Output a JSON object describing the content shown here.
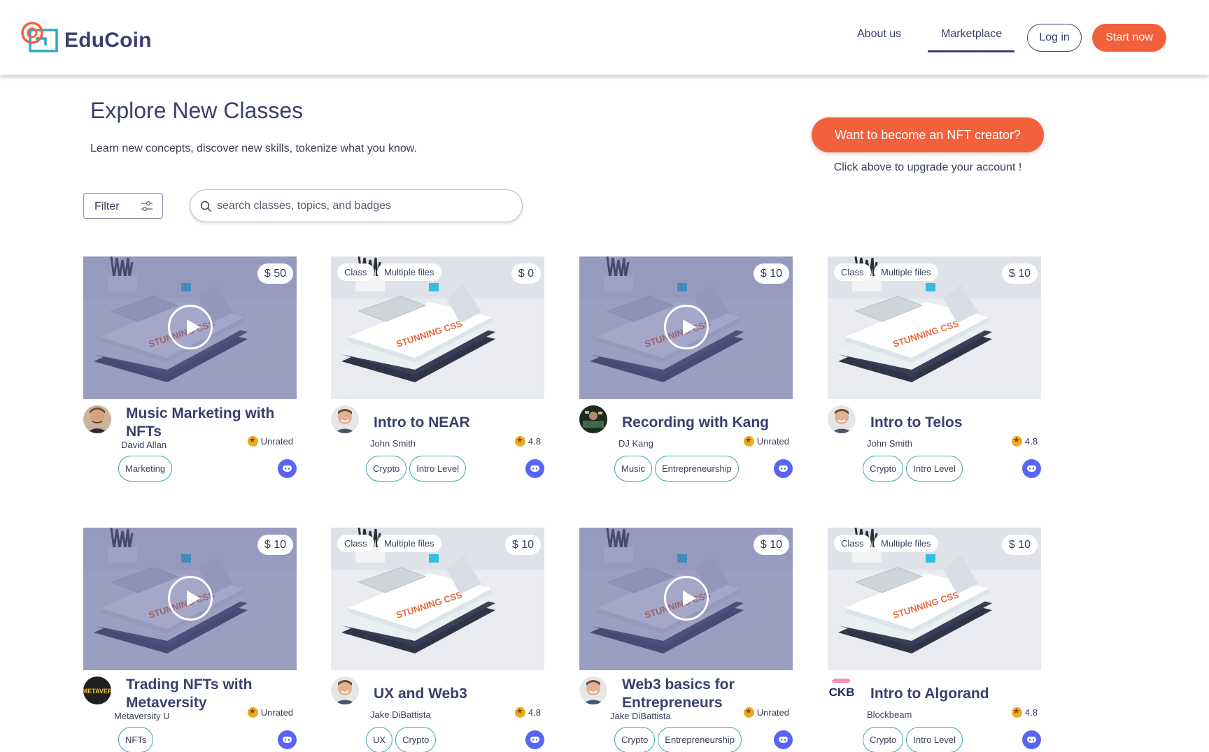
{
  "app": {
    "name": "EduCoin"
  },
  "nav": {
    "about": "About us",
    "marketplace": "Marketplace",
    "login": "Log in",
    "start": "Start now"
  },
  "page": {
    "title": "Explore New Classes",
    "subtitle": "Learn new concepts, discover new skills, tokenize what you know.",
    "creator_button": "Want to become an NFT creator?",
    "creator_note": "Click above to upgrade your account !"
  },
  "filter": {
    "label": "Filter"
  },
  "search": {
    "placeholder": "search classes, topics, and badges",
    "value": ""
  },
  "colors": {
    "accent": "#f2603c",
    "navy": "#3a3f6e",
    "tag_border": "#3aa8a8",
    "discord": "#5865f2",
    "overlay": "#5a5f9b"
  },
  "cards": [
    {
      "title": "Music Marketing with NFTs",
      "author": "David Allan",
      "rating": "Unrated",
      "price": "$ 50",
      "video": true,
      "chips": [],
      "tags": [
        "Marketing"
      ],
      "avatar": "man-mustache"
    },
    {
      "title": "Intro to NEAR",
      "author": "John Smith",
      "rating": "4.8",
      "price": "$ 0",
      "video": false,
      "chips": [
        "Class",
        "Multiple files"
      ],
      "tags": [
        "Crypto",
        "Intro Level"
      ],
      "avatar": "man-smiling"
    },
    {
      "title": "Recording with Kang",
      "author": "DJ Kang",
      "rating": "Unrated",
      "price": "$ 10",
      "video": true,
      "chips": [],
      "tags": [
        "Music",
        "Entrepreneurship"
      ],
      "avatar": "dj-studio"
    },
    {
      "title": "Intro to Telos",
      "author": "John Smith",
      "rating": "4.8",
      "price": "$ 10",
      "video": false,
      "chips": [
        "Class",
        "Multiple files"
      ],
      "tags": [
        "Crypto",
        "Intro Level"
      ],
      "avatar": "man-smiling"
    },
    {
      "title": "Trading NFTs with Metaversity",
      "author": "Metaversity U",
      "rating": "Unrated",
      "price": "$ 10",
      "video": true,
      "chips": [],
      "tags": [
        "NFTs"
      ],
      "avatar": "metaversity-logo",
      "avatar_text": "METAVER"
    },
    {
      "title": "UX and Web3",
      "author": "Jake DiBattista",
      "rating": "4.8",
      "price": "$ 10",
      "video": false,
      "chips": [
        "Class",
        "Multiple files"
      ],
      "tags": [
        "UX",
        "Crypto"
      ],
      "avatar": "man-smiling"
    },
    {
      "title": "Web3 basics for Entrepreneurs",
      "author": "Jake DiBattista",
      "rating": "Unrated",
      "price": "$ 10",
      "video": true,
      "chips": [],
      "tags": [
        "Crypto",
        "Entrepreneurship"
      ],
      "avatar": "man-smiling"
    },
    {
      "title": "Intro to Algorand",
      "author": "Blockbeam",
      "rating": "4.8",
      "price": "$ 10",
      "video": false,
      "chips": [
        "Class",
        "Multiple files"
      ],
      "tags": [
        "Crypto",
        "Intro Level"
      ],
      "avatar": "blockbeam-logo",
      "avatar_text": "CKB"
    }
  ]
}
